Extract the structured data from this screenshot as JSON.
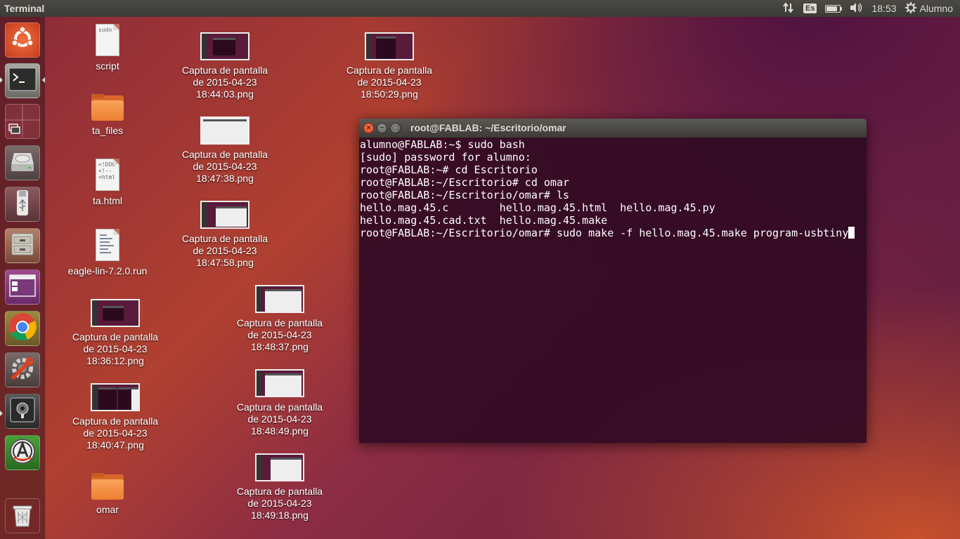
{
  "top_panel": {
    "title": "Terminal",
    "lang": "Es",
    "time": "18:53",
    "user": "Alumno",
    "battery_level": 0.9
  },
  "launcher": {
    "items": [
      {
        "name": "dash-home",
        "icon": "ubuntu-logo-icon"
      },
      {
        "name": "terminal",
        "icon": "terminal-icon"
      },
      {
        "name": "workspace-switcher",
        "icon": "workspace-icon"
      },
      {
        "name": "hard-disk",
        "icon": "hard-disk-icon"
      },
      {
        "name": "usb-drive",
        "icon": "usb-icon"
      },
      {
        "name": "files",
        "icon": "file-cabinet-icon"
      },
      {
        "name": "window-app",
        "icon": "window-icon"
      },
      {
        "name": "chrome",
        "icon": "chrome-icon"
      },
      {
        "name": "system-settings",
        "icon": "settings-wrench-icon"
      },
      {
        "name": "safe",
        "icon": "safe-icon"
      },
      {
        "name": "software-updater",
        "icon": "software-updater-icon"
      },
      {
        "name": "trash",
        "icon": "trash-icon"
      }
    ]
  },
  "desktop": {
    "script": {
      "label": "script",
      "doc_text": "sudo"
    },
    "ta_files": {
      "label": "ta_files"
    },
    "ta_html": {
      "label": "ta.html",
      "doc_text": "<!DOC\n<!--\n<html"
    },
    "eagle": {
      "label": "eagle-lin-7.2.0.run"
    },
    "omar": {
      "label": "omar"
    },
    "cap_1": {
      "l1": "Captura de pantalla",
      "l2": "de 2015-04-23",
      "l3": "18:44:03.png"
    },
    "cap_2": {
      "l1": "Captura de pantalla",
      "l2": "de 2015-04-23",
      "l3": "18:50:29.png"
    },
    "cap_3": {
      "l1": "Captura de pantalla",
      "l2": "de 2015-04-23",
      "l3": "18:47:38.png"
    },
    "cap_4": {
      "l1": "Captura de pantalla",
      "l2": "de 2015-04-23",
      "l3": "18:47:58.png"
    },
    "cap_5": {
      "l1": "Captura de pantalla",
      "l2": "de 2015-04-23",
      "l3": "18:36:12.png"
    },
    "cap_6": {
      "l1": "Captura de pantalla",
      "l2": "de 2015-04-23",
      "l3": "18:48:37.png"
    },
    "cap_7": {
      "l1": "Captura de pantalla",
      "l2": "de 2015-04-23",
      "l3": "18:40:47.png"
    },
    "cap_8": {
      "l1": "Captura de pantalla",
      "l2": "de 2015-04-23",
      "l3": "18:48:49.png"
    },
    "cap_9": {
      "l1": "Captura de pantalla",
      "l2": "de 2015-04-23",
      "l3": "18:49:18.png"
    }
  },
  "terminal": {
    "title": "root@FABLAB: ~/Escritorio/omar",
    "lines": [
      "alumno@FABLAB:~$ sudo bash",
      "[sudo] password for alumno:",
      "root@FABLAB:~# cd Escritorio",
      "root@FABLAB:~/Escritorio# cd omar",
      "root@FABLAB:~/Escritorio/omar# ls",
      "hello.mag.45.c        hello.mag.45.html  hello.mag.45.py",
      "hello.mag.45.cad.txt  hello.mag.45.make",
      "root@FABLAB:~/Escritorio/omar# sudo make -f hello.mag.45.make program-usbtiny"
    ]
  },
  "colors": {
    "terminal_bg": "#300a24",
    "panel_bg": "#3c3b37",
    "close_button": "#e0461a"
  }
}
